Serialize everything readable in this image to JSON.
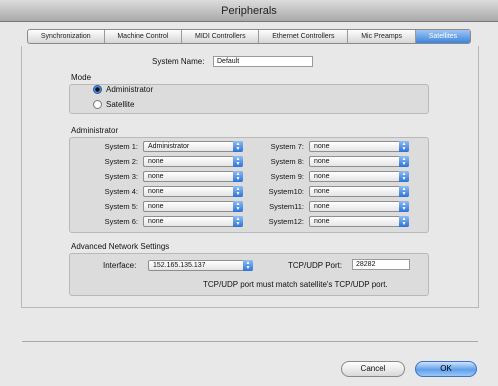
{
  "window": {
    "title": "Peripherals"
  },
  "tabs": [
    {
      "label": "Synchronization",
      "active": false
    },
    {
      "label": "Machine Control",
      "active": false
    },
    {
      "label": "MIDI Controllers",
      "active": false
    },
    {
      "label": "Ethernet Controllers",
      "active": false
    },
    {
      "label": "Mic Preamps",
      "active": false
    },
    {
      "label": "Satellites",
      "active": true
    }
  ],
  "system_name": {
    "label": "System Name:",
    "value": "Default"
  },
  "mode": {
    "title": "Mode",
    "options": [
      {
        "label": "Administrator",
        "selected": true
      },
      {
        "label": "Satellite",
        "selected": false
      }
    ]
  },
  "administrator": {
    "title": "Administrator",
    "systems_left": [
      {
        "label": "System 1:",
        "value": "Administrator"
      },
      {
        "label": "System 2:",
        "value": "none"
      },
      {
        "label": "System 3:",
        "value": "none"
      },
      {
        "label": "System 4:",
        "value": "none"
      },
      {
        "label": "System 5:",
        "value": "none"
      },
      {
        "label": "System 6:",
        "value": "none"
      }
    ],
    "systems_right": [
      {
        "label": "System 7:",
        "value": "none"
      },
      {
        "label": "System 8:",
        "value": "none"
      },
      {
        "label": "System 9:",
        "value": "none"
      },
      {
        "label": "System10:",
        "value": "none"
      },
      {
        "label": "System11:",
        "value": "none"
      },
      {
        "label": "System12:",
        "value": "none"
      }
    ]
  },
  "network": {
    "title": "Advanced Network Settings",
    "interface_label": "Interface:",
    "interface_value": "152.165.135.137",
    "port_label": "TCP/UDP Port:",
    "port_value": "28282",
    "note": "TCP/UDP port must match satellite's TCP/UDP port."
  },
  "buttons": {
    "cancel": "Cancel",
    "ok": "OK"
  },
  "colors": {
    "accent": "#3d84dd"
  }
}
